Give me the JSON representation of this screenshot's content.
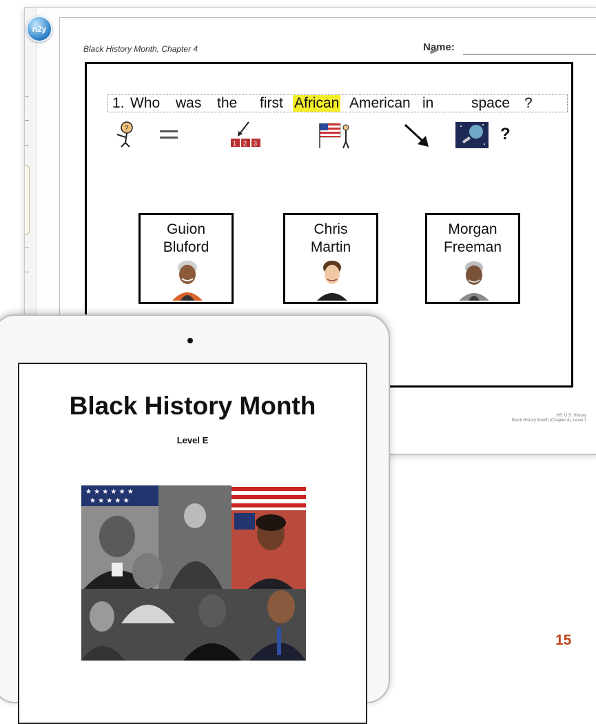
{
  "worksheet": {
    "logo_text": "n2y",
    "header": "Black History Month, Chapter 4",
    "name_label": "Name:",
    "question": {
      "number": "1.",
      "words": [
        "Who",
        "was",
        "the",
        "first",
        "African",
        "American",
        "in",
        "space",
        "?"
      ],
      "highlighted_word": "African",
      "highlight_color": "#f5ef2a",
      "symbols": [
        "who-symbol",
        "equals-symbol",
        "first-symbol",
        "american-symbol",
        "in-arrow-symbol",
        "space-symbol"
      ],
      "symbol_question_mark": "?"
    },
    "answers": [
      {
        "line1": "Guion",
        "line2": "Bluford",
        "portrait": "guion-bluford-portrait"
      },
      {
        "line1": "Chris",
        "line2": "Martin",
        "portrait": "chris-martin-portrait"
      },
      {
        "line1": "Morgan",
        "line2": "Freeman",
        "portrait": "morgan-freeman-portrait"
      }
    ],
    "footer_line1": "HS: U.S. History",
    "footer_line2": "Black History Month (Chapter 4), Level 1"
  },
  "tablet": {
    "title": "Black History Month",
    "subtitle": "Level E",
    "collage": "black-history-figures-collage"
  },
  "page_number": "15",
  "colors": {
    "page_number": "#c0461b",
    "logo": "#2c7fc4"
  }
}
